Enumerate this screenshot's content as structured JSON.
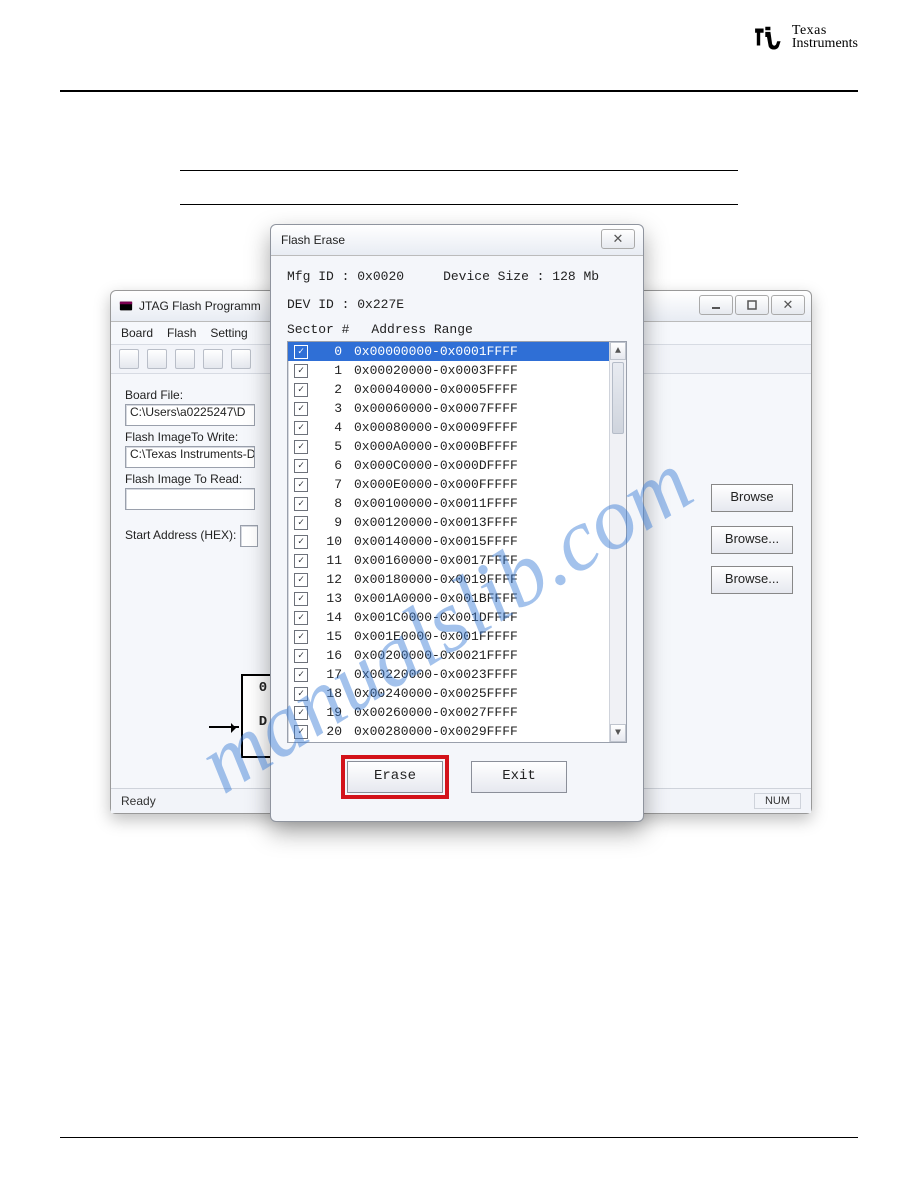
{
  "brand": {
    "line1": "Texas",
    "line2": "Instruments"
  },
  "main": {
    "title": "JTAG Flash Programm",
    "menu": [
      "Board",
      "Flash",
      "Setting"
    ],
    "labels": {
      "boardFile": "Board File:",
      "imgWrite": "Flash ImageTo Write:",
      "imgRead": "Flash Image To Read:",
      "startAddr": "Start Address (HEX):"
    },
    "values": {
      "boardFile": "C:\\Users\\a0225247\\D",
      "imgWrite": "C:\\Texas Instruments-D",
      "imgRead": "",
      "startAddr": ""
    },
    "buttons": {
      "browse": "Browse",
      "browseDots": "Browse..."
    },
    "status": {
      "left": "Ready",
      "right": "NUM"
    },
    "diag": {
      "a": "0",
      "b": "D"
    }
  },
  "dlg": {
    "title": "Flash Erase",
    "mfgLabel": "Mfg ID :",
    "mfg": "0x0020",
    "sizeLabel": "Device Size :",
    "size": "128 Mb",
    "devLabel": "DEV ID :",
    "dev": "0x227E",
    "colSector": "Sector #",
    "colRange": "Address Range",
    "rows": [
      {
        "n": "0",
        "r": "0x00000000-0x0001FFFF",
        "sel": true
      },
      {
        "n": "1",
        "r": "0x00020000-0x0003FFFF"
      },
      {
        "n": "2",
        "r": "0x00040000-0x0005FFFF"
      },
      {
        "n": "3",
        "r": "0x00060000-0x0007FFFF"
      },
      {
        "n": "4",
        "r": "0x00080000-0x0009FFFF"
      },
      {
        "n": "5",
        "r": "0x000A0000-0x000BFFFF"
      },
      {
        "n": "6",
        "r": "0x000C0000-0x000DFFFF"
      },
      {
        "n": "7",
        "r": "0x000E0000-0x000FFFFF"
      },
      {
        "n": "8",
        "r": "0x00100000-0x0011FFFF"
      },
      {
        "n": "9",
        "r": "0x00120000-0x0013FFFF"
      },
      {
        "n": "10",
        "r": "0x00140000-0x0015FFFF"
      },
      {
        "n": "11",
        "r": "0x00160000-0x0017FFFF"
      },
      {
        "n": "12",
        "r": "0x00180000-0x0019FFFF"
      },
      {
        "n": "13",
        "r": "0x001A0000-0x001BFFFF"
      },
      {
        "n": "14",
        "r": "0x001C0000-0x001DFFFF"
      },
      {
        "n": "15",
        "r": "0x001E0000-0x001FFFFF"
      },
      {
        "n": "16",
        "r": "0x00200000-0x0021FFFF"
      },
      {
        "n": "17",
        "r": "0x00220000-0x0023FFFF"
      },
      {
        "n": "18",
        "r": "0x00240000-0x0025FFFF"
      },
      {
        "n": "19",
        "r": "0x00260000-0x0027FFFF"
      },
      {
        "n": "20",
        "r": "0x00280000-0x0029FFFF"
      }
    ],
    "buttons": {
      "erase": "Erase",
      "exit": "Exit"
    }
  }
}
